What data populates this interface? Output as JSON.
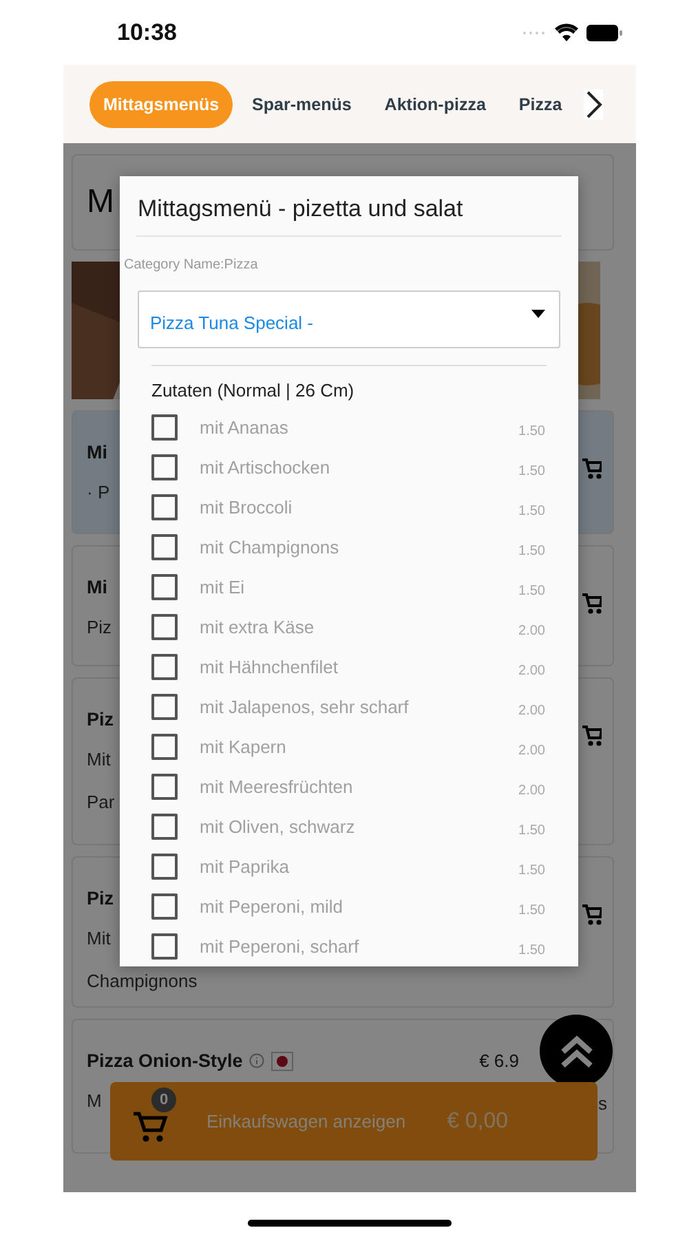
{
  "status_bar": {
    "time": "10:38"
  },
  "tabs": [
    {
      "label": "Mittagsmenüs",
      "selected": true
    },
    {
      "label": "Spar-menüs",
      "selected": false
    },
    {
      "label": "Aktion-pizza",
      "selected": false
    },
    {
      "label": "Pizza",
      "selected": false
    }
  ],
  "cards": [
    {
      "kind": "heading",
      "title": "M"
    },
    {
      "kind": "picture"
    },
    {
      "kind": "item",
      "title": "Mi",
      "lines": [
        "· P"
      ],
      "highlighted": true,
      "cart_button": true
    },
    {
      "kind": "item",
      "title": "Mi",
      "lines": [
        "Piz"
      ],
      "highlighted": false,
      "cart_button": true
    },
    {
      "kind": "item",
      "title": "Piz",
      "lines": [
        "Mit",
        "Par"
      ],
      "highlighted": false,
      "cart_button": true
    },
    {
      "kind": "item",
      "title": "Piz",
      "lines": [
        "Mit",
        "Champignons"
      ],
      "highlighted": false,
      "cart_button": true
    },
    {
      "kind": "item",
      "title": "Pizza Onion-Style",
      "info": true,
      "flag": true,
      "price": "€ 6.9",
      "lines": [
        "M"
      ],
      "tail": "s",
      "highlighted": false,
      "cart_button": false
    }
  ],
  "cart_bar": {
    "count": "0",
    "label": "Einkaufswagen anzeigen",
    "total": "€ 0,00"
  },
  "modal": {
    "title": "Mittagsmenü - pizetta und salat",
    "category": "Category Name:Pizza",
    "select_value": "Pizza Tuna Special -",
    "section": "Zutaten (Normal | 26 Cm)",
    "options": [
      {
        "name": "mit Ananas",
        "price": "1.50",
        "checked": false
      },
      {
        "name": "mit Artischocken",
        "price": "1.50",
        "checked": false
      },
      {
        "name": "mit Broccoli",
        "price": "1.50",
        "checked": false
      },
      {
        "name": "mit Champignons",
        "price": "1.50",
        "checked": false
      },
      {
        "name": "mit Ei",
        "price": "1.50",
        "checked": false
      },
      {
        "name": "mit extra Käse",
        "price": "2.00",
        "checked": false
      },
      {
        "name": "mit Hähnchenfilet",
        "price": "2.00",
        "checked": false
      },
      {
        "name": "mit Jalapenos, sehr scharf",
        "price": "2.00",
        "checked": false
      },
      {
        "name": "mit Kapern",
        "price": "2.00",
        "checked": false
      },
      {
        "name": "mit Meeresfrüchten",
        "price": "2.00",
        "checked": false
      },
      {
        "name": "mit Oliven, schwarz",
        "price": "1.50",
        "checked": false
      },
      {
        "name": "mit Paprika",
        "price": "1.50",
        "checked": false
      },
      {
        "name": "mit Peperoni, mild",
        "price": "1.50",
        "checked": false
      },
      {
        "name": "mit Peperoni, scharf",
        "price": "1.50",
        "checked": false
      }
    ]
  }
}
